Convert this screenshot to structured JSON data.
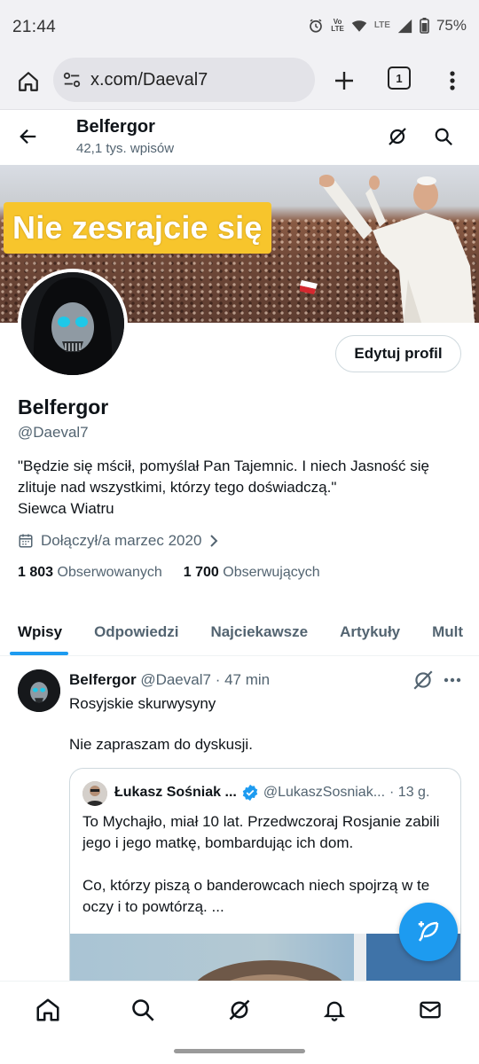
{
  "status_bar": {
    "time": "21:44",
    "volte": "Vo\nLTE",
    "lte": "LTE",
    "battery": "75%"
  },
  "browser": {
    "url": "x.com/Daeval7",
    "tab_count": "1"
  },
  "header": {
    "name": "Belfergor",
    "posts_count": "42,1 tys. wpisów"
  },
  "banner": {
    "caption": "Nie zesrajcie się"
  },
  "profile": {
    "edit_label": "Edytuj profil",
    "name": "Belfergor",
    "handle": "@Daeval7",
    "bio": "\"Będzie się mścił, pomyślał Pan Tajemnic. I niech Jasność się zlituje nad wszystkimi, którzy tego doświadczą.\"\nSiewca Wiatru",
    "joined": "Dołączył/a marzec 2020",
    "following_count": "1 803",
    "following_label": "Obserwowanych",
    "followers_count": "1 700",
    "followers_label": "Obserwujących"
  },
  "tabs": [
    {
      "label": "Wpisy",
      "active": true
    },
    {
      "label": "Odpowiedzi",
      "active": false
    },
    {
      "label": "Najciekawsze",
      "active": false
    },
    {
      "label": "Artykuły",
      "active": false
    },
    {
      "label": "Mult",
      "active": false
    }
  ],
  "post": {
    "author": "Belfergor",
    "handle": "@Daeval7",
    "time": "· 47 min",
    "text": "Rosyjskie skurwysyny\n\nNie zapraszam do dyskusji.",
    "quote": {
      "author": "Łukasz Sośniak ...",
      "handle": "@LukaszSosniak...",
      "time": "· 13 g.",
      "text": "To Mychajło, miał 10 lat. Przedwczoraj Rosjanie zabili jego i jego matkę, bombardując ich dom.\n\nCo, którzy piszą o banderowcach niech spojrzą w te oczy i to powtórzą. ..."
    }
  },
  "colors": {
    "accent": "#1d9bf0",
    "banner_caption_bg": "#f7c52c",
    "text_secondary": "#536471"
  },
  "nav_icons": [
    "home-icon",
    "search-icon",
    "grok-icon",
    "notifications-icon",
    "messages-icon"
  ]
}
